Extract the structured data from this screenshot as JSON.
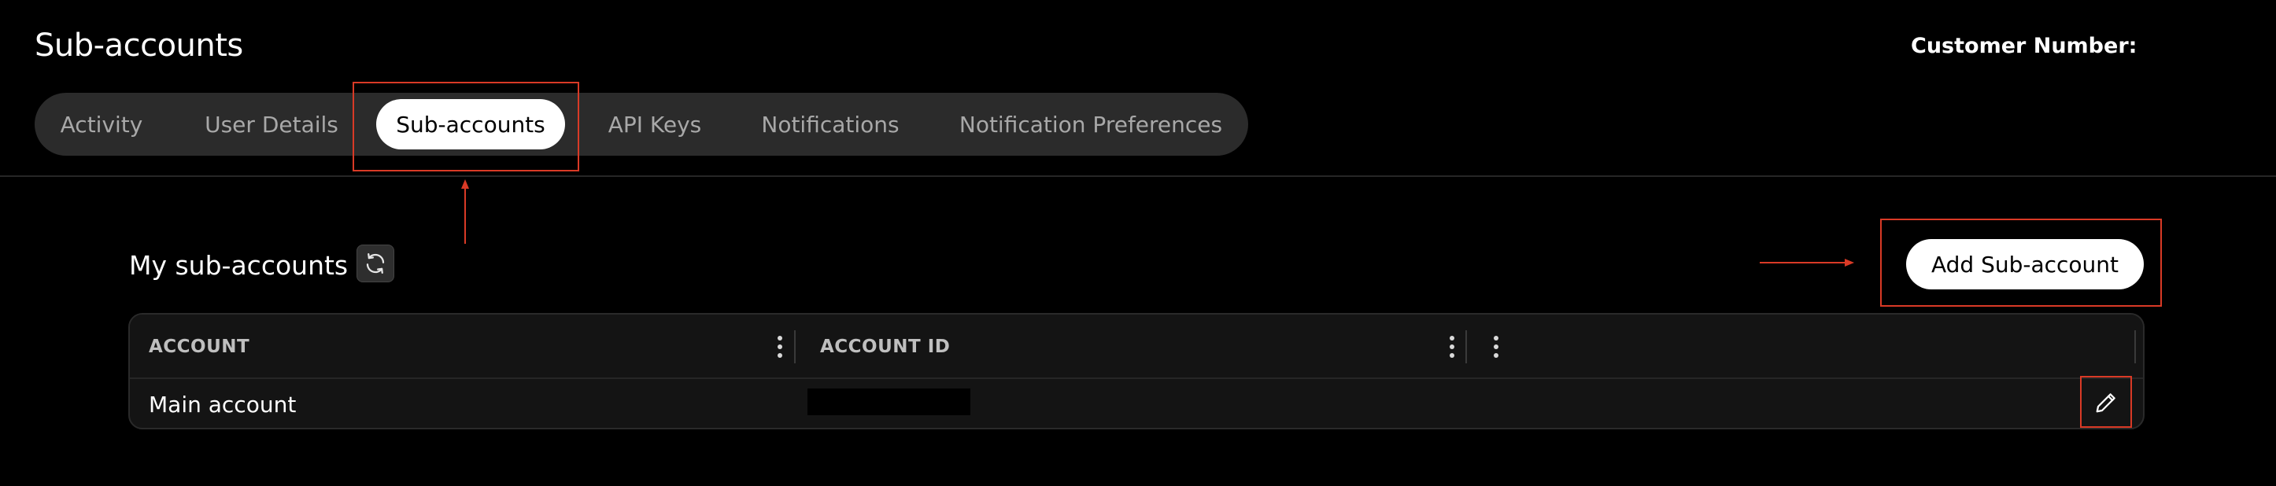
{
  "header": {
    "title": "Sub-accounts",
    "customer_number_label": "Customer Number:"
  },
  "tabs": [
    {
      "label": "Activity",
      "active": false
    },
    {
      "label": "User Details",
      "active": false
    },
    {
      "label": "Sub-accounts",
      "active": true
    },
    {
      "label": "API Keys",
      "active": false
    },
    {
      "label": "Notifications",
      "active": false
    },
    {
      "label": "Notification Preferences",
      "active": false
    }
  ],
  "section": {
    "title": "My sub-accounts",
    "refresh_icon": "refresh-icon",
    "add_button_label": "Add Sub-account"
  },
  "table": {
    "columns": [
      "ACCOUNT",
      "ACCOUNT ID"
    ],
    "rows": [
      {
        "account": "Main account",
        "account_id_redacted": true
      }
    ]
  },
  "colors": {
    "background": "#000000",
    "annotation_red": "#d93a26",
    "tab_bar": "#2b2b2b",
    "table_bg": "#141414"
  },
  "icons": [
    "refresh-icon",
    "kebab-menu-icon",
    "pencil-icon",
    "arrow-up-icon",
    "arrow-right-icon"
  ]
}
